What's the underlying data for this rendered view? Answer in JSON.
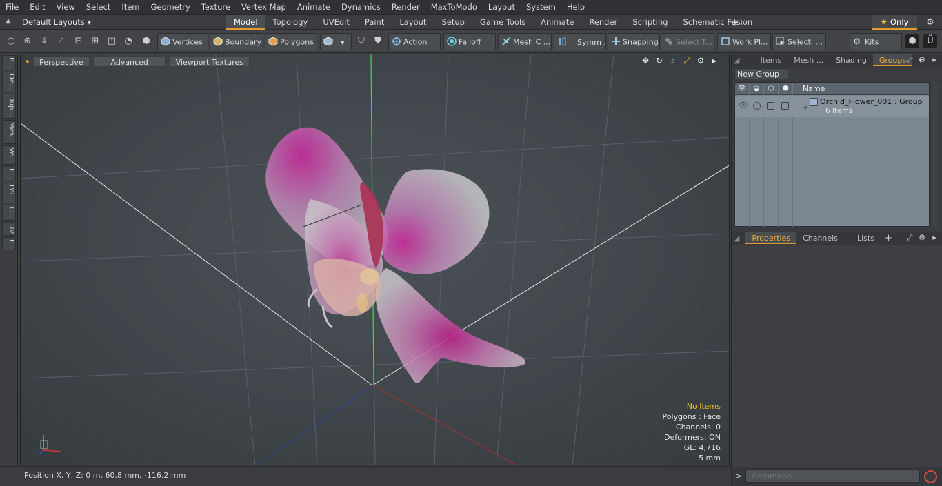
{
  "menu": [
    "File",
    "Edit",
    "View",
    "Select",
    "Item",
    "Geometry",
    "Texture",
    "Vertex Map",
    "Animate",
    "Dynamics",
    "Render",
    "MaxToModo",
    "Layout",
    "System",
    "Help"
  ],
  "layout_bar": {
    "layouts_dropdown": "Default Layouts ▾",
    "tabs": [
      "Model",
      "Topology",
      "UVEdit",
      "Paint",
      "Layout",
      "Setup",
      "Game Tools",
      "Animate",
      "Render",
      "Scripting",
      "Schematic Fusion"
    ],
    "active_tab": "Model",
    "add_tab": "+",
    "only_label": "Only"
  },
  "toolbar": {
    "vertices": "Vertices",
    "boundary": "Boundary",
    "polygons": "Polygons",
    "action": "Action",
    "falloff": "Falloff",
    "mesh_constraints": "Mesh C ...",
    "symmetry": "Symm ...",
    "snapping": "Snapping",
    "select_through": "Select T...",
    "work_plane": "Work Pl...",
    "selection_sets": "Selecti ...",
    "kits": "Kits"
  },
  "left_tabs": [
    "B...",
    "De...",
    "Dup...",
    "Mes...",
    "Ve...",
    "E...",
    "Pol...",
    "C...",
    "UV",
    "F..."
  ],
  "viewport": {
    "perspective": "Perspective",
    "advanced": "Advanced",
    "viewport_textures": "Viewport Textures",
    "info": {
      "items": "No Items",
      "polygons": "Polygons : Face",
      "channels": "Channels: 0",
      "deformers": "Deformers: ON",
      "gl": "GL: 4,716",
      "scale": "5 mm"
    }
  },
  "status": {
    "position": "Position X, Y, Z:   0 m, 60.8 mm, -116.2 mm"
  },
  "right_panel": {
    "top_tabs": [
      "Items",
      "Mesh ...",
      "Shading",
      "Groups"
    ],
    "active_top_tab": "Groups",
    "new_group": "New Group",
    "column_name": "Name",
    "group": {
      "name": "Orchid_Flower_001 : Group",
      "count": "6 Items"
    },
    "bottom_tabs": [
      "Properties",
      "Channels",
      "Lists"
    ],
    "active_bottom_tab": "Properties",
    "command_placeholder": "Command"
  },
  "colors": {
    "accent": "#e59b2c",
    "viewport_bg": "#43494e",
    "panel_bg": "#3a3c3f",
    "info_highlight": "#f0c020"
  }
}
